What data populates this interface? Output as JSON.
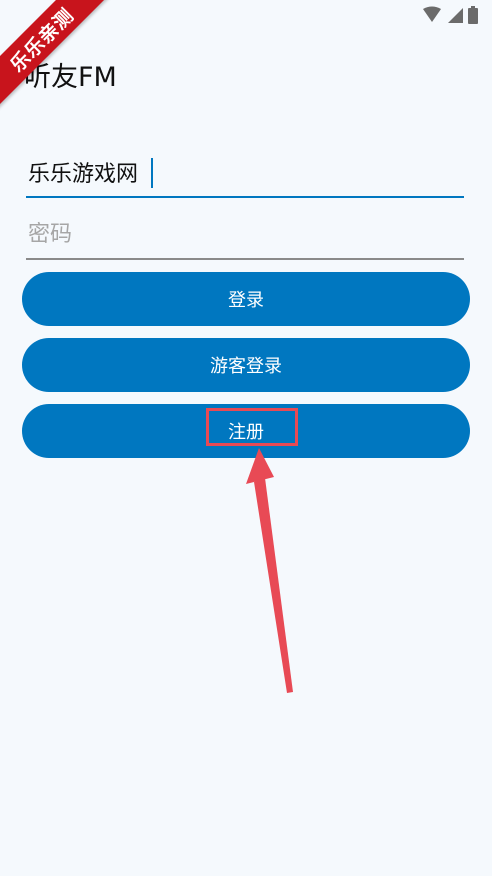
{
  "watermark": {
    "text": "乐乐亲测",
    "color": "#c8141c"
  },
  "status_bar": {
    "icons": [
      "wifi-icon",
      "signal-icon",
      "battery-icon"
    ]
  },
  "app": {
    "title": "听友FM"
  },
  "login_form": {
    "username_value": "乐乐游戏网",
    "password_placeholder": "密码",
    "login_label": "登录",
    "guest_login_label": "游客登录",
    "register_label": "注册"
  },
  "annotation": {
    "highlight_color": "#e84a55",
    "icon": "arrow-icon"
  },
  "colors": {
    "primary": "#0077c0",
    "background": "#f5f9fd"
  }
}
